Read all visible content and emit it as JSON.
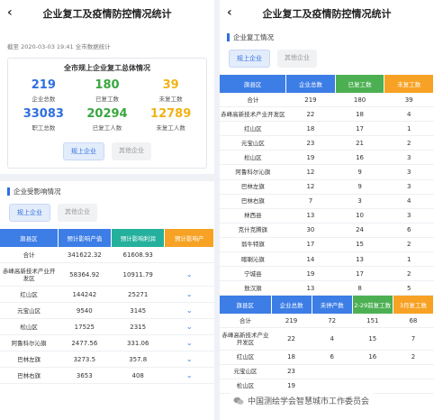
{
  "left": {
    "title": "企业复工及疫情防控情况统计",
    "timestamp": "截至 2020-03-03 19:41 全市数据统计",
    "overview": {
      "title": "全市规上企业复工总体情况",
      "stats": [
        {
          "value": "219",
          "label": "企业总数",
          "color": "#2f6fe0"
        },
        {
          "value": "180",
          "label": "已复工数",
          "color": "#3aa640"
        },
        {
          "value": "39",
          "label": "未复工数",
          "color": "#f0b317"
        },
        {
          "value": "33083",
          "label": "职工总数",
          "color": "#2f6fe0"
        },
        {
          "value": "20294",
          "label": "已复工人数",
          "color": "#3aa640"
        },
        {
          "value": "12789",
          "label": "未复工人数",
          "color": "#f0b317"
        }
      ],
      "tabs": [
        "规上企业",
        "其他企业"
      ]
    },
    "impact": {
      "title": "企业受影响情况",
      "tabs": [
        "规上企业",
        "其他企业"
      ],
      "headers": [
        "旗县区",
        "预计影响产值",
        "预计影响利润",
        "预计影响产"
      ],
      "rows": [
        {
          "name": "合计",
          "a": "341622.32",
          "b": "61608.93",
          "chev": ""
        },
        {
          "name": "赤峰高新技术产业开发区",
          "a": "58364.92",
          "b": "10911.79",
          "chev": "⌄"
        },
        {
          "name": "红山区",
          "a": "144242",
          "b": "25271",
          "chev": "⌄"
        },
        {
          "name": "元宝山区",
          "a": "9540",
          "b": "3145",
          "chev": "⌄"
        },
        {
          "name": "松山区",
          "a": "17525",
          "b": "2315",
          "chev": "⌄"
        },
        {
          "name": "阿鲁科尔沁旗",
          "a": "2477.56",
          "b": "331.06",
          "chev": "⌄"
        },
        {
          "name": "巴林左旗",
          "a": "3273.5",
          "b": "357.8",
          "chev": "⌄"
        },
        {
          "name": "巴林右旗",
          "a": "3653",
          "b": "408",
          "chev": "⌄"
        }
      ]
    }
  },
  "right": {
    "title": "企业复工及疫情防控情况统计",
    "section_title": "企业复工情况",
    "tabs": [
      "规上企业",
      "其他企业"
    ],
    "table1": {
      "headers": [
        "旗县区",
        "企业总数",
        "已复工数",
        "未复工数"
      ],
      "rows": [
        [
          "合计",
          "219",
          "180",
          "39"
        ],
        [
          "赤峰高新技术产业开发区",
          "22",
          "18",
          "4"
        ],
        [
          "红山区",
          "18",
          "17",
          "1"
        ],
        [
          "元宝山区",
          "23",
          "21",
          "2"
        ],
        [
          "松山区",
          "19",
          "16",
          "3"
        ],
        [
          "阿鲁科尔沁旗",
          "12",
          "9",
          "3"
        ],
        [
          "巴林左旗",
          "12",
          "9",
          "3"
        ],
        [
          "巴林右旗",
          "7",
          "3",
          "4"
        ],
        [
          "林西县",
          "13",
          "10",
          "3"
        ],
        [
          "克什克腾旗",
          "30",
          "24",
          "6"
        ],
        [
          "翁牛特旗",
          "17",
          "15",
          "2"
        ],
        [
          "喀喇沁旗",
          "14",
          "13",
          "1"
        ],
        [
          "宁城县",
          "19",
          "17",
          "2"
        ],
        [
          "敖汉旗",
          "13",
          "8",
          "5"
        ]
      ]
    },
    "table2": {
      "headers": [
        "旗县区",
        "企业总数",
        "未停产数",
        "2-29前复工数",
        "3月复工数"
      ],
      "rows": [
        [
          "合计",
          "219",
          "72",
          "151",
          "68"
        ],
        [
          "赤峰高新技术产业开发区",
          "22",
          "4",
          "15",
          "7"
        ],
        [
          "红山区",
          "18",
          "6",
          "16",
          "2"
        ],
        [
          "元宝山区",
          "23",
          "",
          "",
          ""
        ],
        [
          "松山区",
          "19",
          "",
          "",
          ""
        ]
      ]
    }
  },
  "watermark": "中国测绘学会智慧城市工作委员会"
}
